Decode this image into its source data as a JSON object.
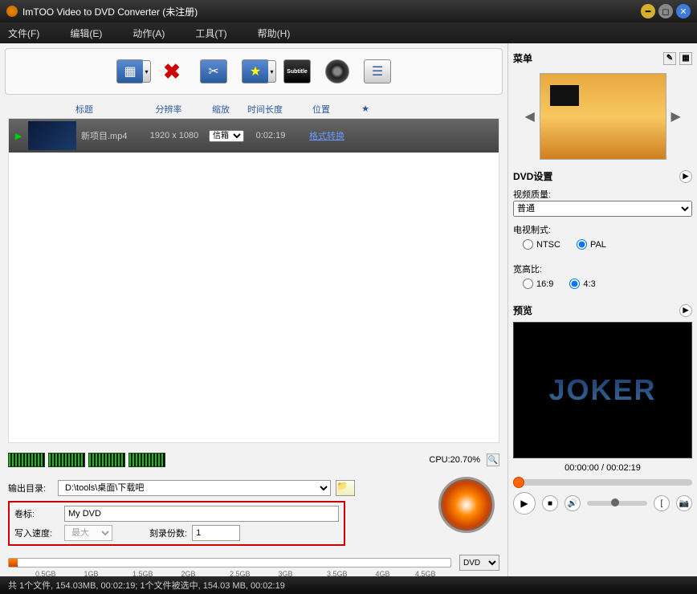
{
  "window": {
    "title": "ImTOO Video to DVD Converter (未注册)"
  },
  "menu": {
    "file": "文件(F)",
    "edit": "编辑(E)",
    "action": "动作(A)",
    "tools": "工具(T)",
    "help": "帮助(H)"
  },
  "columns": {
    "title": "标题",
    "resolution": "分辨率",
    "zoom": "缩放",
    "duration": "时间长度",
    "position": "位置",
    "star": "★"
  },
  "files": [
    {
      "name": "新项目.mp4",
      "resolution": "1920 x 1080",
      "zoom": "信箱",
      "duration": "0:02:19",
      "convert": "格式转换"
    }
  ],
  "cpu": {
    "label": "CPU:20.70%"
  },
  "output": {
    "dirlabel": "输出目录:",
    "dir": "D:\\tools\\桌面\\下载吧",
    "vollabel": "卷标:",
    "volume": "My DVD",
    "speedlabel": "写入速度:",
    "speed": "最大",
    "copieslabel": "刻录份数:",
    "copies": "1",
    "dvdtype": "DVD"
  },
  "sizeticks": [
    "0.5GB",
    "1GB",
    "1.5GB",
    "2GB",
    "2.5GB",
    "3GB",
    "3.5GB",
    "4GB",
    "4.5GB"
  ],
  "status": "共 1个文件, 154.03MB,  00:02:19; 1个文件被选中, 154.03 MB,  00:02:19",
  "sidebar": {
    "menu": "菜单",
    "dvdset": "DVD设置",
    "quality_label": "视频质量:",
    "quality": "普通",
    "tvstd_label": "电视制式:",
    "tvstd_ntsc": "NTSC",
    "tvstd_pal": "PAL",
    "aspect_label": "宽高比:",
    "aspect_169": "16:9",
    "aspect_43": "4:3",
    "preview_label": "预览",
    "time": "00:00:00 / 00:02:19"
  }
}
